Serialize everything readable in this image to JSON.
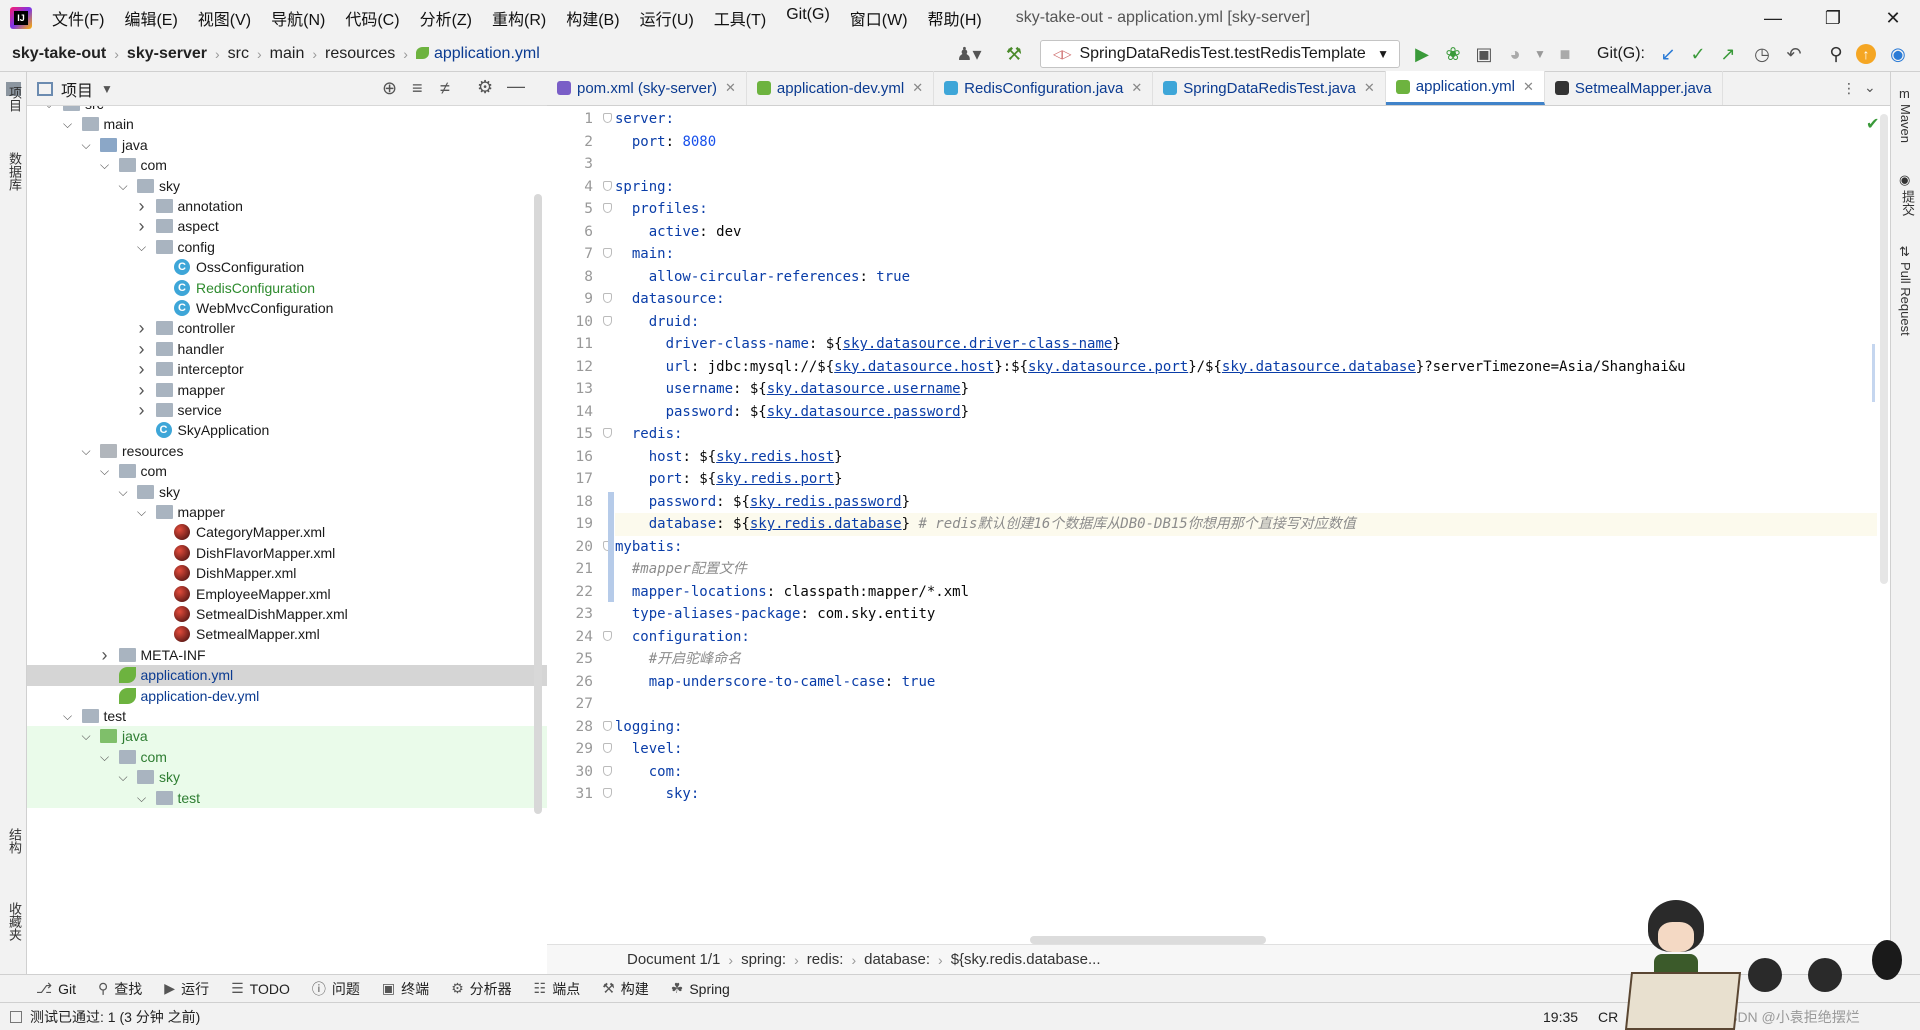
{
  "menubar": {
    "items": [
      "文件(F)",
      "编辑(E)",
      "视图(V)",
      "导航(N)",
      "代码(C)",
      "分析(Z)",
      "重构(R)",
      "构建(B)",
      "运行(U)",
      "工具(T)",
      "Git(G)",
      "窗口(W)",
      "帮助(H)"
    ],
    "title": "sky-take-out - application.yml [sky-server]"
  },
  "breadcrumb": [
    "sky-take-out",
    "sky-server",
    "src",
    "main",
    "resources",
    "application.yml"
  ],
  "toolbar": {
    "run_config": "SpringDataRedisTest.testRedisTemplate",
    "git_label": "Git(G):"
  },
  "project_panel": {
    "title": "项目"
  },
  "left_strip": {
    "top": "项目",
    "db": "数据库",
    "structure": "结构",
    "bookmarks": "收藏夹"
  },
  "right_strip": {
    "maven": "Maven",
    "commit": "提交",
    "pr": "Pull Request"
  },
  "tree": [
    {
      "label": "src",
      "indent": 0,
      "kind": "folder",
      "arrow": "open"
    },
    {
      "label": "main",
      "indent": 1,
      "kind": "folder",
      "arrow": "open"
    },
    {
      "label": "java",
      "indent": 2,
      "kind": "folder-blue",
      "arrow": "open"
    },
    {
      "label": "com",
      "indent": 3,
      "kind": "folder",
      "arrow": "open"
    },
    {
      "label": "sky",
      "indent": 4,
      "kind": "folder",
      "arrow": "open"
    },
    {
      "label": "annotation",
      "indent": 5,
      "kind": "folder",
      "arrow": "closed"
    },
    {
      "label": "aspect",
      "indent": 5,
      "kind": "folder",
      "arrow": "closed"
    },
    {
      "label": "config",
      "indent": 5,
      "kind": "folder",
      "arrow": "open"
    },
    {
      "label": "OssConfiguration",
      "indent": 6,
      "kind": "class"
    },
    {
      "label": "RedisConfiguration",
      "indent": 6,
      "kind": "class",
      "color": "#2e8b2e"
    },
    {
      "label": "WebMvcConfiguration",
      "indent": 6,
      "kind": "class"
    },
    {
      "label": "controller",
      "indent": 5,
      "kind": "folder",
      "arrow": "closed"
    },
    {
      "label": "handler",
      "indent": 5,
      "kind": "folder",
      "arrow": "closed"
    },
    {
      "label": "interceptor",
      "indent": 5,
      "kind": "folder",
      "arrow": "closed"
    },
    {
      "label": "mapper",
      "indent": 5,
      "kind": "folder",
      "arrow": "closed"
    },
    {
      "label": "service",
      "indent": 5,
      "kind": "folder",
      "arrow": "closed"
    },
    {
      "label": "SkyApplication",
      "indent": 5,
      "kind": "class"
    },
    {
      "label": "resources",
      "indent": 2,
      "kind": "folder-res",
      "arrow": "open"
    },
    {
      "label": "com",
      "indent": 3,
      "kind": "folder",
      "arrow": "open"
    },
    {
      "label": "sky",
      "indent": 4,
      "kind": "folder",
      "arrow": "open"
    },
    {
      "label": "mapper",
      "indent": 5,
      "kind": "folder",
      "arrow": "open"
    },
    {
      "label": "CategoryMapper.xml",
      "indent": 6,
      "kind": "xml"
    },
    {
      "label": "DishFlavorMapper.xml",
      "indent": 6,
      "kind": "xml"
    },
    {
      "label": "DishMapper.xml",
      "indent": 6,
      "kind": "xml"
    },
    {
      "label": "EmployeeMapper.xml",
      "indent": 6,
      "kind": "xml"
    },
    {
      "label": "SetmealDishMapper.xml",
      "indent": 6,
      "kind": "xml"
    },
    {
      "label": "SetmealMapper.xml",
      "indent": 6,
      "kind": "xml"
    },
    {
      "label": "META-INF",
      "indent": 3,
      "kind": "folder",
      "arrow": "closed"
    },
    {
      "label": "application.yml",
      "indent": 3,
      "kind": "yml",
      "color": "#0b3b91",
      "selected": true
    },
    {
      "label": "application-dev.yml",
      "indent": 3,
      "kind": "yml",
      "color": "#0b3b91"
    },
    {
      "label": "test",
      "indent": 1,
      "kind": "folder",
      "arrow": "open"
    },
    {
      "label": "java",
      "indent": 2,
      "kind": "folder-green",
      "arrow": "open",
      "test": true,
      "color": "#2e7d32"
    },
    {
      "label": "com",
      "indent": 3,
      "kind": "folder",
      "arrow": "open",
      "test": true,
      "color": "#2e7d32"
    },
    {
      "label": "sky",
      "indent": 4,
      "kind": "folder",
      "arrow": "open",
      "test": true,
      "color": "#2e7d32"
    },
    {
      "label": "test",
      "indent": 5,
      "kind": "folder",
      "arrow": "open",
      "test": true,
      "color": "#2e7d32"
    }
  ],
  "tabs": [
    {
      "label": "pom.xml (sky-server)",
      "icon": "#7a5ec7"
    },
    {
      "label": "application-dev.yml",
      "icon": "#6db33f"
    },
    {
      "label": "RedisConfiguration.java",
      "icon": "#3ea6d8"
    },
    {
      "label": "SpringDataRedisTest.java",
      "icon": "#3ea6d8"
    },
    {
      "label": "application.yml",
      "icon": "#6db33f",
      "active": true
    },
    {
      "label": "SetmealMapper.java",
      "icon": "#333"
    }
  ],
  "code_lines": [
    [
      [
        "k",
        "server:"
      ]
    ],
    [
      [
        "t",
        "  "
      ],
      [
        "k",
        "port"
      ],
      [
        "t",
        ": "
      ],
      [
        "n",
        "8080"
      ]
    ],
    [],
    [
      [
        "k",
        "spring:"
      ]
    ],
    [
      [
        "t",
        "  "
      ],
      [
        "k",
        "profiles:"
      ]
    ],
    [
      [
        "t",
        "    "
      ],
      [
        "k",
        "active"
      ],
      [
        "t",
        ": dev"
      ]
    ],
    [
      [
        "t",
        "  "
      ],
      [
        "k",
        "main:"
      ]
    ],
    [
      [
        "t",
        "    "
      ],
      [
        "k",
        "allow-circular-references"
      ],
      [
        "t",
        ": "
      ],
      [
        "k",
        "true"
      ]
    ],
    [
      [
        "t",
        "  "
      ],
      [
        "k",
        "datasource:"
      ]
    ],
    [
      [
        "t",
        "    "
      ],
      [
        "k",
        "druid:"
      ]
    ],
    [
      [
        "t",
        "      "
      ],
      [
        "k",
        "driver-class-name"
      ],
      [
        "t",
        ": ${"
      ],
      [
        "r",
        "sky.datasource.driver-class-name"
      ],
      [
        "t",
        "}"
      ]
    ],
    [
      [
        "t",
        "      "
      ],
      [
        "k",
        "url"
      ],
      [
        "t",
        ": jdbc:mysql://${"
      ],
      [
        "r",
        "sky.datasource.host"
      ],
      [
        "t",
        "}:${"
      ],
      [
        "r",
        "sky.datasource.port"
      ],
      [
        "t",
        "}/${"
      ],
      [
        "r",
        "sky.datasource.database"
      ],
      [
        "t",
        "}?serverTimezone=Asia/Shanghai&u"
      ]
    ],
    [
      [
        "t",
        "      "
      ],
      [
        "k",
        "username"
      ],
      [
        "t",
        ": ${"
      ],
      [
        "r",
        "sky.datasource.username"
      ],
      [
        "t",
        "}"
      ]
    ],
    [
      [
        "t",
        "      "
      ],
      [
        "k",
        "password"
      ],
      [
        "t",
        ": ${"
      ],
      [
        "r",
        "sky.datasource.password"
      ],
      [
        "t",
        "}"
      ]
    ],
    [
      [
        "t",
        "  "
      ],
      [
        "k",
        "redis:"
      ]
    ],
    [
      [
        "t",
        "    "
      ],
      [
        "k",
        "host"
      ],
      [
        "t",
        ": ${"
      ],
      [
        "r",
        "sky.redis.host"
      ],
      [
        "t",
        "}"
      ]
    ],
    [
      [
        "t",
        "    "
      ],
      [
        "k",
        "port"
      ],
      [
        "t",
        ": ${"
      ],
      [
        "r",
        "sky.redis.port"
      ],
      [
        "t",
        "}"
      ]
    ],
    [
      [
        "t",
        "    "
      ],
      [
        "k",
        "password"
      ],
      [
        "t",
        ": ${"
      ],
      [
        "r",
        "sky.redis.password"
      ],
      [
        "t",
        "}"
      ]
    ],
    [
      [
        "t",
        "    "
      ],
      [
        "k",
        "database"
      ],
      [
        "t",
        ": ${"
      ],
      [
        "r",
        "sky.redis.database"
      ],
      [
        "t",
        "} "
      ],
      [
        "c",
        "# redis默认创建16个数据库从DB0-DB15你想用那个直接写对应数值"
      ]
    ],
    [
      [
        "k",
        "mybatis:"
      ]
    ],
    [
      [
        "t",
        "  "
      ],
      [
        "c",
        "#mapper配置文件"
      ]
    ],
    [
      [
        "t",
        "  "
      ],
      [
        "k",
        "mapper-locations"
      ],
      [
        "t",
        ": classpath:mapper/*.xml"
      ]
    ],
    [
      [
        "t",
        "  "
      ],
      [
        "k",
        "type-aliases-package"
      ],
      [
        "t",
        ": com.sky.entity"
      ]
    ],
    [
      [
        "t",
        "  "
      ],
      [
        "k",
        "configuration:"
      ]
    ],
    [
      [
        "t",
        "    "
      ],
      [
        "c",
        "#开启驼峰命名"
      ]
    ],
    [
      [
        "t",
        "    "
      ],
      [
        "k",
        "map-underscore-to-camel-case"
      ],
      [
        "t",
        ": "
      ],
      [
        "k",
        "true"
      ]
    ],
    [],
    [
      [
        "k",
        "logging:"
      ]
    ],
    [
      [
        "t",
        "  "
      ],
      [
        "k",
        "level:"
      ]
    ],
    [
      [
        "t",
        "    "
      ],
      [
        "k",
        "com:"
      ]
    ],
    [
      [
        "t",
        "      "
      ],
      [
        "k",
        "sky:"
      ]
    ]
  ],
  "highlight_line": 19,
  "editor_breadcrumb": [
    "Document 1/1",
    "spring:",
    "redis:",
    "database:",
    "${sky.redis.database..."
  ],
  "bottom_tools": [
    "Git",
    "查找",
    "运行",
    "TODO",
    "问题",
    "终端",
    "分析器",
    "端点",
    "构建",
    "Spring"
  ],
  "status": {
    "message": "测试已通过: 1 (3 分钟 之前)",
    "position": "19:35",
    "line_sep": "CR",
    "watermark": "CSDN @小袁拒绝摆烂"
  }
}
